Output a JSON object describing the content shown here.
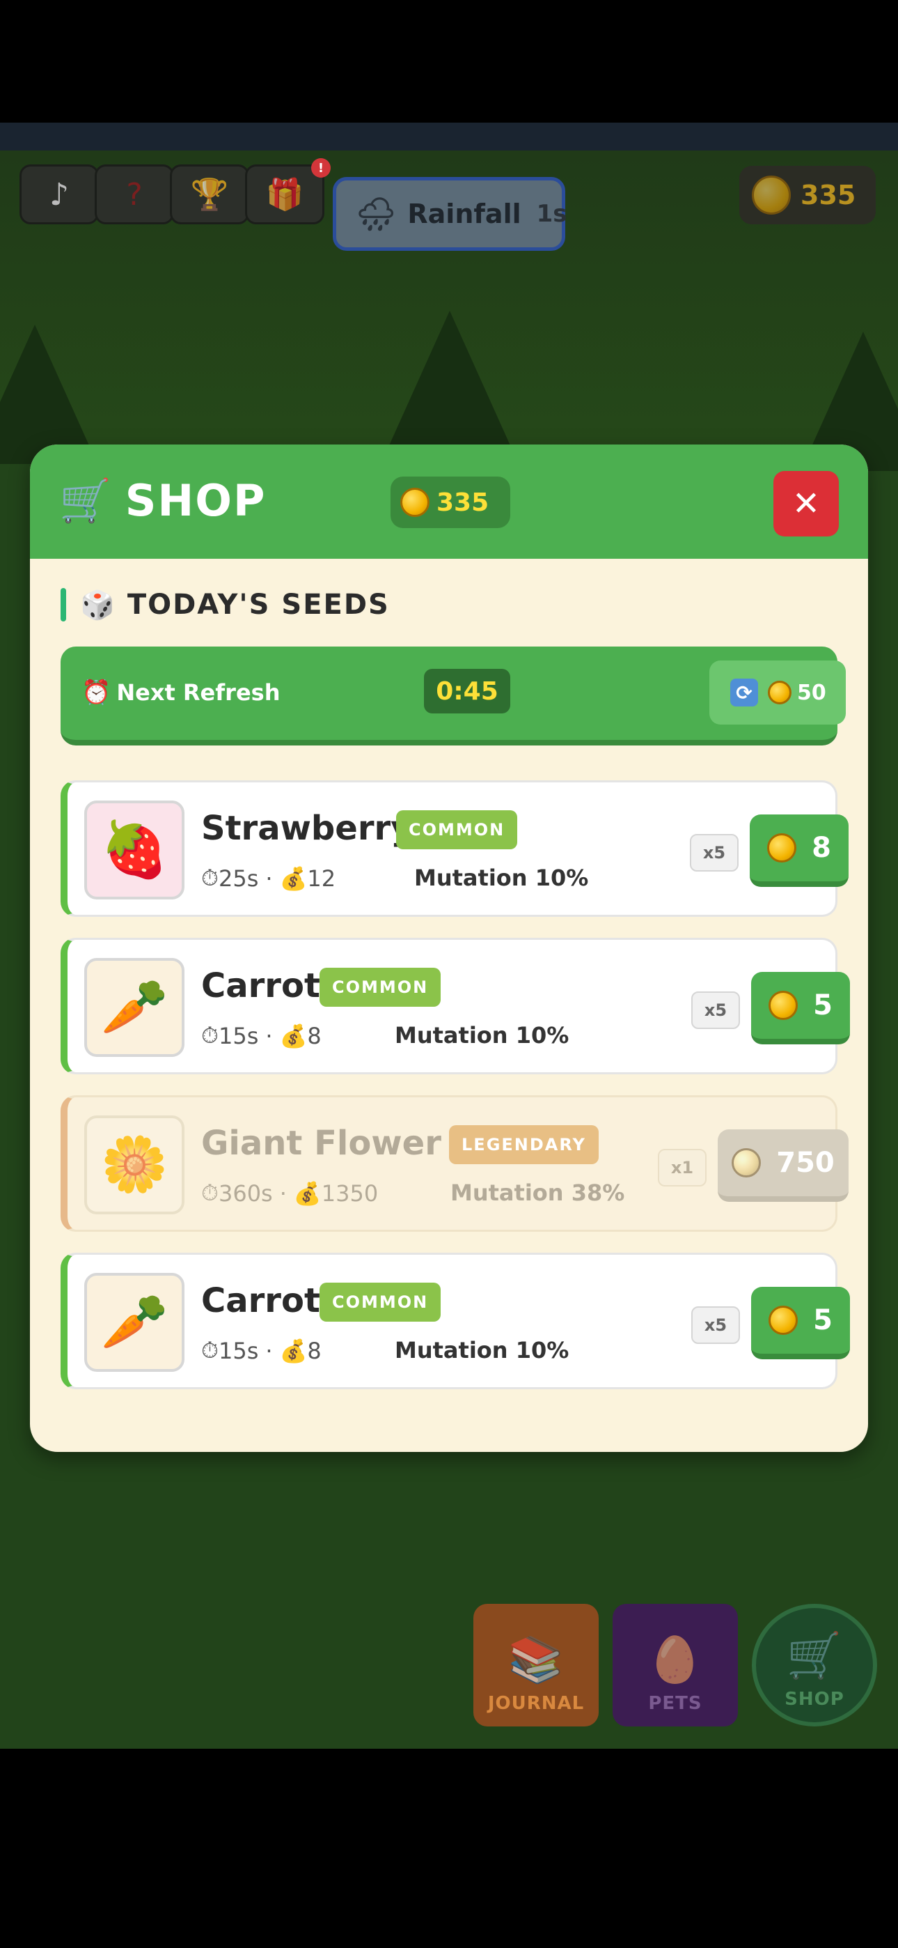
{
  "hud": {
    "buttons": [
      {
        "icon": "music-note-icon",
        "glyph": "♪"
      },
      {
        "icon": "question-icon",
        "glyph": "?"
      },
      {
        "icon": "trophy-icon",
        "glyph": "🏆"
      },
      {
        "icon": "gift-icon",
        "glyph": "🎁",
        "badge": "!"
      }
    ],
    "weather": {
      "icon": "rain-cloud-icon",
      "glyph": "🌧",
      "label": "Rainfall",
      "time": "1s"
    },
    "coins": "335"
  },
  "dock": {
    "journal": {
      "label": "JOURNAL",
      "glyph": "📚",
      "color": "#d8782d"
    },
    "pets": {
      "label": "PETS",
      "glyph": "🥚",
      "color": "#5a2a7a"
    },
    "shop": {
      "label": "SHOP",
      "glyph": "🛒",
      "color": "#1f6b3a"
    }
  },
  "shop": {
    "title": "SHOP",
    "title_icon": "🛒",
    "coins": "335",
    "close_glyph": "✕",
    "section_icon": "🎲",
    "section_title": "TODAY'S SEEDS",
    "refresh": {
      "icon": "⏰",
      "label": "Next Refresh",
      "timer": "0:45",
      "reroll_icon": "🔄",
      "reroll_cost": "50"
    },
    "items": [
      {
        "name": "Strawberry",
        "rarity": "COMMON",
        "rarity_color": "#8bc34a",
        "glyph": "🍓",
        "thumb_bg": "#fbe3ea",
        "time": "25s",
        "value": "12",
        "mutation": "Mutation 10%",
        "qty": "x5",
        "price": "8",
        "available": true
      },
      {
        "name": "Carrot",
        "rarity": "COMMON",
        "rarity_color": "#8bc34a",
        "glyph": "🥕",
        "thumb_bg": "#fbf1dd",
        "time": "15s",
        "value": "8",
        "mutation": "Mutation 10%",
        "qty": "x5",
        "price": "5",
        "available": true
      },
      {
        "name": "Giant Flower",
        "rarity": "LEGENDARY",
        "rarity_color": "#e8bf84",
        "glyph": "🌼",
        "thumb_bg": "#fbf3e2",
        "time": "360s",
        "value": "1350",
        "mutation": "Mutation 38%",
        "qty": "x1",
        "price": "750",
        "available": false
      },
      {
        "name": "Carrot",
        "rarity": "COMMON",
        "rarity_color": "#8bc34a",
        "glyph": "🥕",
        "thumb_bg": "#fbf1dd",
        "time": "15s",
        "value": "8",
        "mutation": "Mutation 10%",
        "qty": "x5",
        "price": "5",
        "available": true
      }
    ]
  }
}
